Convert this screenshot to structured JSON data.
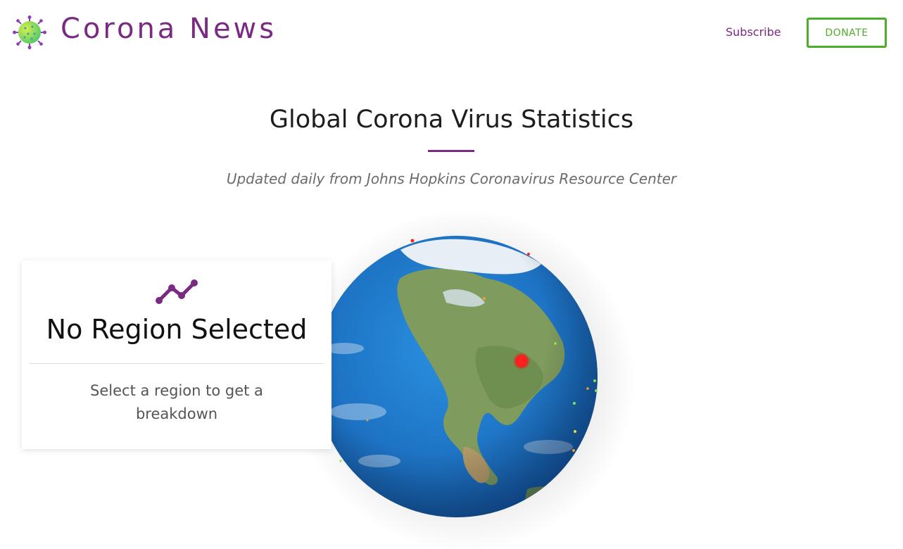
{
  "header": {
    "brand": "Corona News",
    "subscribe_label": "Subscribe",
    "donate_label": "DONATE",
    "logo_icon": "virus-icon"
  },
  "main": {
    "title": "Global Corona Virus Statistics",
    "subtitle": "Updated daily from Johns Hopkins Coronavirus Resource Center",
    "globe_icon": "globe-icon"
  },
  "region_card": {
    "icon": "trend-line-icon",
    "title": "No Region Selected",
    "text": "Select a region to get a breakdown"
  },
  "colors": {
    "brand_purple": "#7b2a83",
    "accent_green": "#4caf2a",
    "ocean_blue": "#1f7fd1",
    "hotspot_red": "#ff1a1a"
  }
}
